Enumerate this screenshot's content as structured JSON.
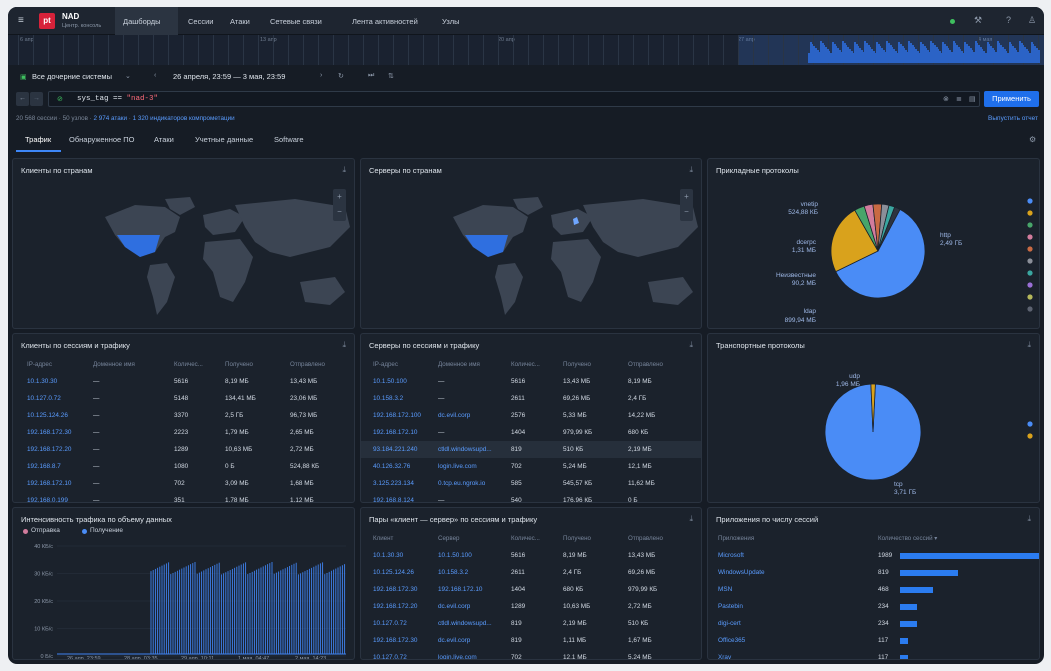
{
  "nav": {
    "app_title": "NAD",
    "app_subtitle": "Центр. консоль",
    "logo": "pt",
    "items": [
      "Дашборды",
      "Сессии",
      "Атаки",
      "Сетевые связи",
      "Лента активностей",
      "Узлы"
    ]
  },
  "timeline": {
    "labels": [
      "6 апр",
      "13 апр",
      "20 апр",
      "27 апр",
      "4 мая"
    ]
  },
  "toolbar": {
    "systems": "Все дочерние системы",
    "range": "26 апреля, 23:59 — 3 мая, 23:59",
    "apply": "Применить",
    "report": "Выпустить отчет"
  },
  "query": {
    "prefix": "sys_tag == ",
    "value": "\"nad-3\""
  },
  "summary": {
    "sessions": "20 568 сессии",
    "nodes": "50 узлов",
    "attacks": "2 974 атаки",
    "ioc": "1 320 индикаторов компрометации"
  },
  "tabs": [
    "Трафик",
    "Обнаруженное ПО",
    "Атаки",
    "Учетные данные",
    "Software"
  ],
  "panels": {
    "clients_countries": "Клиенты по странам",
    "servers_countries": "Серверы по странам",
    "app_protocols": "Прикладные протоколы",
    "clients_sessions": "Клиенты по сессиям и трафику",
    "servers_sessions": "Серверы по сессиям и трафику",
    "transport": "Транспортные протоколы",
    "intensity": "Интенсивность трафика по объему данных",
    "pairs": "Пары «клиент — сервер» по сессиям и трафику",
    "apps": "Приложения по числу сессий"
  },
  "app_pie": {
    "labels": [
      [
        "vnetip",
        "524,88 КБ"
      ],
      [
        "dcerpc",
        "1,31 МБ"
      ],
      [
        "Неизвестные",
        "90,2 МБ"
      ],
      [
        "ldap",
        "899,94 МБ"
      ],
      [
        "http",
        "2,49 ГБ"
      ]
    ],
    "colors": [
      "#4a8cf6",
      "#d9a21c",
      "#48a56a",
      "#d27c9d",
      "#c86a43",
      "#8b8f99",
      "#3aa6a0",
      "#9a6fd6",
      "#b5b85b",
      "#5c6270"
    ]
  },
  "transport_pie": {
    "udp": [
      "udp",
      "1,96 МБ"
    ],
    "tcp": [
      "tcp",
      "3,71 ГБ"
    ]
  },
  "clients_table": {
    "headers": [
      "IP-адрес",
      "Доменное имя",
      "Количес...",
      "Получено",
      "Отправлено"
    ],
    "rows": [
      [
        "10.1.30.30",
        "—",
        "5616",
        "8,19 МБ",
        "13,43 МБ"
      ],
      [
        "10.127.0.72",
        "—",
        "5148",
        "134,41 МБ",
        "23,06 МБ"
      ],
      [
        "10.125.124.26",
        "—",
        "3370",
        "2,5 ГБ",
        "96,73 МБ"
      ],
      [
        "192.168.172.30",
        "—",
        "2223",
        "1,79 МБ",
        "2,65 МБ"
      ],
      [
        "192.168.172.20",
        "—",
        "1289",
        "10,63 МБ",
        "2,72 МБ"
      ],
      [
        "192.168.8.7",
        "—",
        "1080",
        "0 Б",
        "524,88 КБ"
      ],
      [
        "192.168.172.10",
        "—",
        "702",
        "3,09 МБ",
        "1,68 МБ"
      ],
      [
        "192.168.0.199",
        "—",
        "351",
        "1,78 МБ",
        "1,12 МБ"
      ]
    ]
  },
  "servers_table": {
    "headers": [
      "IP-адрес",
      "Доменное имя",
      "Количес...",
      "Получено",
      "Отправлено"
    ],
    "rows": [
      [
        "10.1.50.100",
        "—",
        "5616",
        "13,43 МБ",
        "8,19 МБ"
      ],
      [
        "10.158.3.2",
        "—",
        "2611",
        "69,26 МБ",
        "2,4 ГБ"
      ],
      [
        "192.168.172.100",
        "dc.evil.corp",
        "2576",
        "5,33 МБ",
        "14,22 МБ"
      ],
      [
        "192.168.172.10",
        "—",
        "1404",
        "979,99 КБ",
        "680 КБ"
      ],
      [
        "93.184.221.240",
        "ctldl.windowsupd...",
        "819",
        "510 КБ",
        "2,19 МБ"
      ],
      [
        "40.126.32.76",
        "login.live.com",
        "702",
        "5,24 МБ",
        "12,1 МБ"
      ],
      [
        "3.125.223.134",
        "0.tcp.eu.ngrok.io",
        "585",
        "545,57 КБ",
        "11,62 МБ"
      ],
      [
        "192.168.8.124",
        "—",
        "540",
        "176,96 КБ",
        "0 Б"
      ]
    ]
  },
  "pairs_table": {
    "headers": [
      "Клиент",
      "Сервер",
      "Количес...",
      "Получено",
      "Отправлено"
    ],
    "rows": [
      [
        "10.1.30.30",
        "10.1.50.100",
        "5616",
        "8,19 МБ",
        "13,43 МБ"
      ],
      [
        "10.125.124.26",
        "10.158.3.2",
        "2611",
        "2,4 ГБ",
        "69,26 МБ"
      ],
      [
        "192.168.172.30",
        "192.168.172.10",
        "1404",
        "680 КБ",
        "979,99 КБ"
      ],
      [
        "192.168.172.20",
        "dc.evil.corp",
        "1289",
        "10,63 МБ",
        "2,72 МБ"
      ],
      [
        "10.127.0.72",
        "ctldl.windowsupd...",
        "819",
        "2,19 МБ",
        "510 КБ"
      ],
      [
        "192.168.172.30",
        "dc.evil.corp",
        "819",
        "1,11 МБ",
        "1,67 МБ"
      ],
      [
        "10.127.0.72",
        "login.live.com",
        "702",
        "12,1 МБ",
        "5,24 МБ"
      ],
      [
        "10.127.0.72",
        "0.tcp.eu.ngrok.io",
        "585",
        "11,62 МБ",
        "545,57 КБ"
      ]
    ]
  },
  "apps_bars": {
    "headers": [
      "Приложения",
      "Количество сессий"
    ],
    "rows": [
      [
        "Microsoft",
        1989
      ],
      [
        "WindowsUpdate",
        819
      ],
      [
        "MSN",
        468
      ],
      [
        "Pastebin",
        234
      ],
      [
        "digi-cert",
        234
      ],
      [
        "Office365",
        117
      ],
      [
        "Xray",
        117
      ]
    ]
  },
  "chart_data": {
    "type": "area",
    "legend": [
      "Отправка",
      "Получение"
    ],
    "y_ticks": [
      "40 КБ/с",
      "30 КБ/с",
      "20 КБ/с",
      "10 КБ/с",
      "0 Б/с"
    ],
    "x_ticks": [
      "26 апр, 23:59",
      "28 апр, 03:35",
      "29 апр, 10:11",
      "1 мая, 04:47",
      "2 мая, 14:23"
    ],
    "colors": [
      "#d27c9d",
      "#4a8cf6"
    ]
  }
}
